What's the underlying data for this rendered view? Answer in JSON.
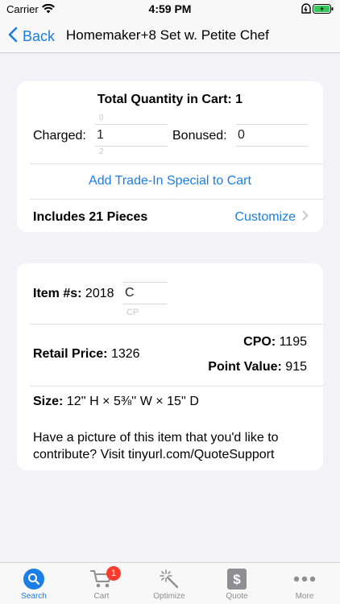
{
  "status_bar": {
    "carrier": "Carrier",
    "time": "4:59 PM"
  },
  "nav": {
    "back_label": "Back",
    "title": "Homemaker+8 Set w. Petite Chef"
  },
  "cart_card": {
    "total_quantity": "Total Quantity in Cart: 1",
    "charged_label": "Charged:",
    "charged_value": "1",
    "bonused_label": "Bonused:",
    "bonused_value": "0",
    "add_trade_in": "Add Trade-In Special to Cart",
    "includes": "Includes 21 Pieces",
    "customize": "Customize"
  },
  "item_card": {
    "item_label": "Item #s:",
    "item_number": "2018",
    "item_suffix": "C",
    "item_suffix_next": "CP",
    "cpo_label": "CPO:",
    "cpo_value": "1195",
    "retail_label": "Retail Price:",
    "retail_value": "1326",
    "point_label": "Point Value:",
    "point_value": "915",
    "size_label": "Size:",
    "size_value": "12'' H × 5⅜'' W × 15'' D",
    "contribute_text": "Have a picture of this item that you'd like to contribute? Visit tinyurl.com/QuoteSupport"
  },
  "tabs": [
    {
      "label": "Search",
      "icon": "search-icon",
      "active": true
    },
    {
      "label": "Cart",
      "icon": "cart-icon",
      "badge": "1"
    },
    {
      "label": "Optimize",
      "icon": "magic-wand-icon"
    },
    {
      "label": "Quote",
      "icon": "dollar-icon"
    },
    {
      "label": "More",
      "icon": "more-icon"
    }
  ],
  "colors": {
    "accent": "#1a7ee6",
    "background": "#f2f2f7",
    "badge": "#ff3b30",
    "battery": "#34c759"
  }
}
